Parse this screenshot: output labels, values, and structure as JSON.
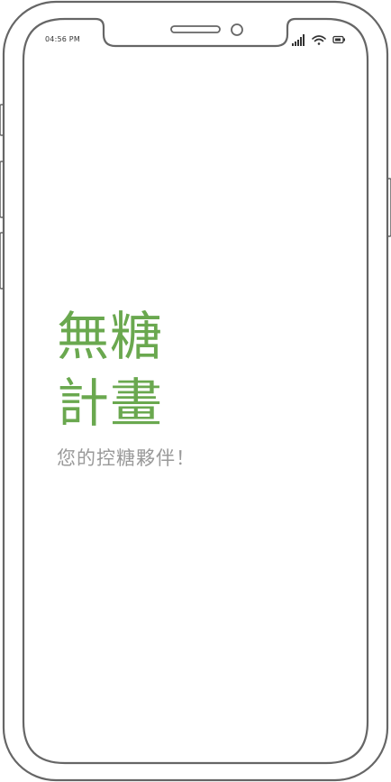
{
  "status_bar": {
    "time": "04:56 PM",
    "icons": [
      "signal-icon",
      "wifi-icon",
      "battery-icon"
    ]
  },
  "splash": {
    "title_line_1": "無糖",
    "title_line_2": "計畫",
    "tagline": "您的控糖夥伴！"
  },
  "colors": {
    "title": "#6aa84f",
    "tagline": "#9a9a9a",
    "frame": "#666666"
  }
}
